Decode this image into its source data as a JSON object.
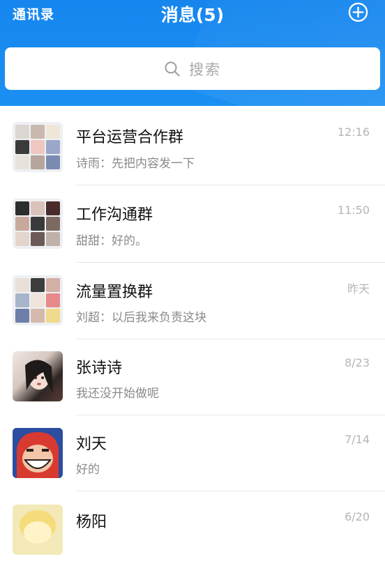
{
  "header": {
    "contacts_label": "通讯录",
    "title": "消息(5)",
    "add_icon": "plus-circle-icon",
    "bg_color": "#1686ee"
  },
  "search": {
    "placeholder": "搜索",
    "icon": "search-icon"
  },
  "conversations": [
    {
      "name": "平台运营合作群",
      "preview": "诗雨：先把内容发一下",
      "time": "12:16",
      "avatar": "group-avatar"
    },
    {
      "name": "工作沟通群",
      "preview": "甜甜：好的。",
      "time": "11:50",
      "avatar": "group-avatar"
    },
    {
      "name": "流量置换群",
      "preview": "刘超：以后我来负责这块",
      "time": "昨天",
      "avatar": "group-avatar"
    },
    {
      "name": "张诗诗",
      "preview": "我还没开始做呢",
      "time": "8/23",
      "avatar": "user-avatar"
    },
    {
      "name": "刘天",
      "preview": "好的",
      "time": "7/14",
      "avatar": "user-avatar"
    },
    {
      "name": "杨阳",
      "preview": "",
      "time": "6/20",
      "avatar": "user-avatar"
    }
  ]
}
